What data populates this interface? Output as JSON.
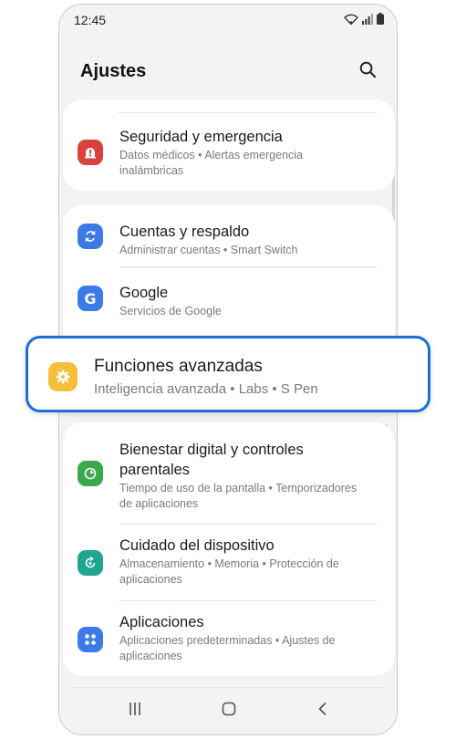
{
  "status_bar": {
    "time": "12:45"
  },
  "header": {
    "title": "Ajustes"
  },
  "sections": {
    "security": {
      "title": "Seguridad y emergencia",
      "subtitle_line1": "Datos médicos  •  Alertas emergencia",
      "subtitle_line2": "inalámbricas",
      "icon_color": "#d9413c"
    },
    "accounts": {
      "title": "Cuentas y respaldo",
      "subtitle": "Administrar cuentas  •  Smart Switch",
      "icon_color": "#3c7ae8"
    },
    "google": {
      "title": "Google",
      "subtitle": "Servicios de Google",
      "icon_color": "#3c7ae8"
    },
    "advanced": {
      "title": "Funciones avanzadas",
      "subtitle": "Inteligencia avanzada  •  Labs  •  S Pen",
      "icon_color": "#f6be3a",
      "highlight_color": "#1a6fd6"
    },
    "wellbeing": {
      "title_line1": "Bienestar digital y controles",
      "title_line2": "parentales",
      "subtitle_line1": "Tiempo de uso de la pantalla  •  Temporizadores",
      "subtitle_line2": "de aplicaciones",
      "icon_color": "#3aa94a"
    },
    "device_care": {
      "title": "Cuidado del dispositivo",
      "subtitle_line1": "Almacenamiento  •  Memoria  •  Protección de",
      "subtitle_line2": "aplicaciones",
      "icon_color": "#20a58f"
    },
    "apps": {
      "title": "Aplicaciones",
      "subtitle_line1": "Aplicaciones predeterminadas  •  Ajustes de",
      "subtitle_line2": "aplicaciones",
      "icon_color": "#3c7ae8"
    }
  },
  "icons": {
    "search": "search-icon",
    "wifi": "wifi-icon",
    "signal": "signal-icon",
    "battery": "battery-icon",
    "recents": "recents-icon",
    "home": "home-icon",
    "back": "back-icon"
  }
}
